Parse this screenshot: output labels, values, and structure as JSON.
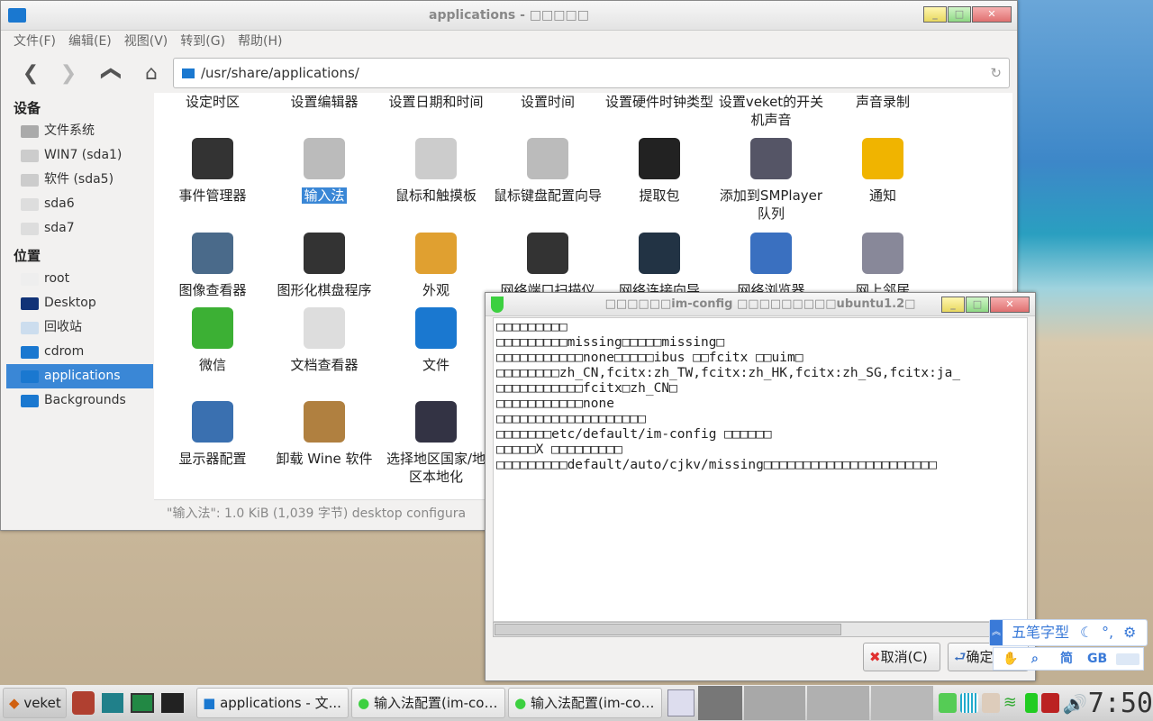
{
  "file_manager": {
    "title": "applications - □□□□□",
    "menu": [
      "文件(F)",
      "编辑(E)",
      "视图(V)",
      "转到(G)",
      "帮助(H)"
    ],
    "path": "/usr/share/applications/",
    "sidebar": {
      "devices_header": "设备",
      "devices": [
        "文件系统",
        "WIN7 (sda1)",
        "软件 (sda5)",
        "sda6",
        "sda7"
      ],
      "places_header": "位置",
      "places": [
        "root",
        "Desktop",
        "回收站",
        "cdrom",
        "applications",
        "Backgrounds"
      ]
    },
    "items": [
      {
        "label": "设定时区",
        "icon": "none"
      },
      {
        "label": "设置编辑器",
        "icon": "none"
      },
      {
        "label": "设置日期和时间",
        "icon": "none"
      },
      {
        "label": "设置时间",
        "icon": "none"
      },
      {
        "label": "设置硬件时钟类型",
        "icon": "none"
      },
      {
        "label": "设置veket的开关机声音",
        "icon": "none"
      },
      {
        "label": "声音录制",
        "icon": "none"
      },
      {
        "label": "事件管理器",
        "icon": "gear-icon",
        "color": "#333"
      },
      {
        "label": "输入法",
        "icon": "keyboard-icon",
        "color": "#bbb",
        "selected": true
      },
      {
        "label": "鼠标和触摸板",
        "icon": "mouse-icon",
        "color": "#ccc"
      },
      {
        "label": "鼠标键盘配置向导",
        "icon": "keyboard-icon",
        "color": "#bbb"
      },
      {
        "label": "提取包",
        "icon": "box-icon",
        "color": "#222"
      },
      {
        "label": "添加到SMPlayer 队列",
        "icon": "film-reel-icon",
        "color": "#556"
      },
      {
        "label": "通知",
        "icon": "bell-icon",
        "color": "#f0b400"
      },
      {
        "label": "图像查看器",
        "icon": "image-icon",
        "color": "#4a6a8a"
      },
      {
        "label": "图形化棋盘程序",
        "icon": "chess-knight-icon",
        "color": "#333"
      },
      {
        "label": "外观",
        "icon": "palette-icon",
        "color": "#e0a030"
      },
      {
        "label": "网络端口扫描仪",
        "icon": "network-icon",
        "color": "#333"
      },
      {
        "label": "网络连接向导",
        "icon": "globe-icon",
        "color": "#234"
      },
      {
        "label": "网络浏览器",
        "icon": "browser-globe-icon",
        "color": "#3a70c0"
      },
      {
        "label": "网上邻居",
        "icon": "computers-icon",
        "color": "#889"
      },
      {
        "label": "微信",
        "icon": "wechat-icon",
        "color": "#3cb034"
      },
      {
        "label": "文档查看器",
        "icon": "document-icon",
        "color": "#ddd"
      },
      {
        "label": "文件",
        "icon": "folder-icon",
        "color": "#1a78d0"
      },
      {
        "label": "显示器配置",
        "icon": "monitor-icon",
        "color": "#3a70b0"
      },
      {
        "label": "卸载 Wine 软件",
        "icon": "wine-box-icon",
        "color": "#b08040"
      },
      {
        "label": "选择地区国家/地区本地化",
        "icon": "flag-icon",
        "color": "#334"
      }
    ],
    "status": "\"输入法\": 1.0 KiB (1,039 字节) desktop configura"
  },
  "dialog": {
    "title": "□□□□□□im-config □□□□□□□□□ubuntu1.2□",
    "lines": [
      "□□□□□□□□□",
      "□□□□□□□□□missing□□□□□missing□",
      "□□□□□□□□□□□none□□□□□ibus □□fcitx □□uim□",
      "□□□□□□□□zh_CN,fcitx:zh_TW,fcitx:zh_HK,fcitx:zh_SG,fcitx:ja_",
      "□□□□□□□□□□□fcitx□zh_CN□",
      "□□□□□□□□□□□none",
      "□□□□□□□□□□□□□□□□□□□",
      "□□□□□□□etc/default/im-config □□□□□□",
      "□□□□□X □□□□□□□□□",
      "□□□□□□□□□default/auto/cjkv/missing□□□□□□□□□□□□□□□□□□□□□□"
    ],
    "cancel": "取消(C)",
    "ok": "确定"
  },
  "ime": {
    "name": "五笔字型",
    "simplified": "简",
    "charset": "GB"
  },
  "taskbar": {
    "start": "veket",
    "tasks": [
      "applications - 文...",
      "输入法配置(im-co…",
      "输入法配置(im-co…"
    ],
    "clock": "7:50"
  }
}
